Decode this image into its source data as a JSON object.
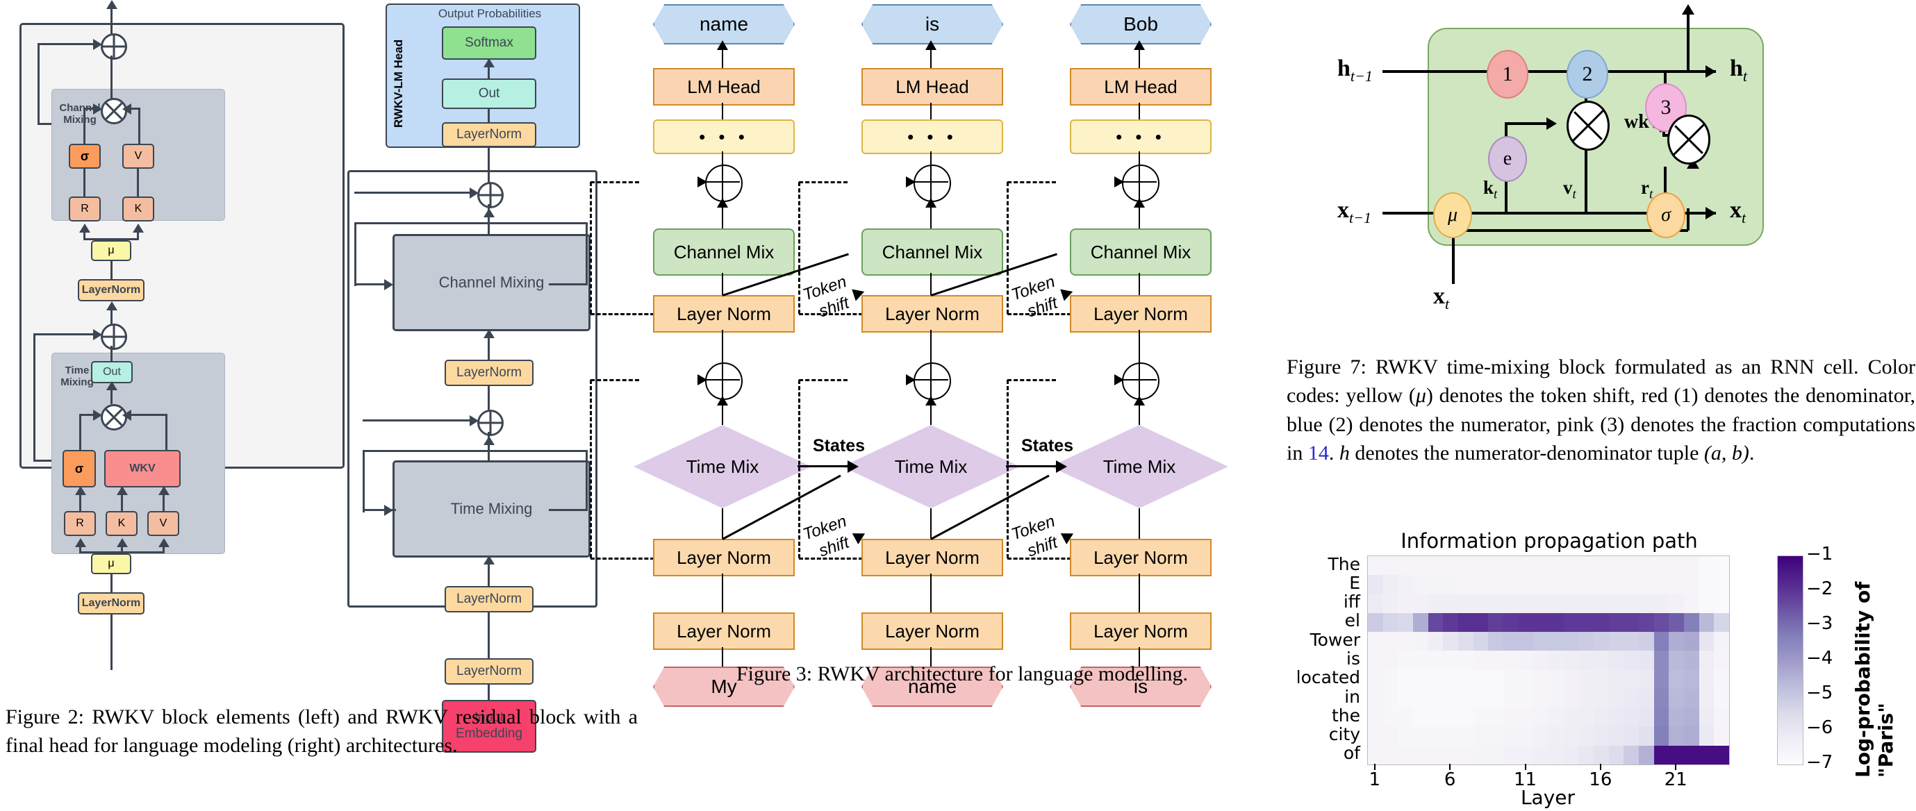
{
  "figure2": {
    "caption": "Figure 2:  RWKV block elements (left) and RWKV residual block with a final head for language modeling (right) architectures.",
    "left_panel": {
      "channel_mixing": {
        "label": "Channel\nMixing",
        "label_line1": "Channel",
        "label_line2": "Mixing",
        "nodes": [
          "σ",
          "V",
          "R",
          "K",
          "μ"
        ],
        "sigma": "σ",
        "v": "V",
        "r": "R",
        "k": "K",
        "mu": "μ"
      },
      "channel_layernorm": "LayerNorm",
      "time_mixing": {
        "label_line1": "Time",
        "label_line2": "Mixing",
        "out": "Out",
        "sigma": "σ",
        "wkv": "WKV",
        "r": "R",
        "k": "K",
        "v": "V",
        "mu": "μ"
      },
      "time_layernorm": "LayerNorm",
      "ops": {
        "add": "⊕",
        "mul": "⊗"
      }
    },
    "right_panel": {
      "head": {
        "title": "Output Probabilities",
        "side_label": "RWKV-LM Head",
        "softmax": "Softmax",
        "out": "Out",
        "layernorm": "LayerNorm"
      },
      "channel_mixing": "Channel Mixing",
      "layernorm_cm": "LayerNorm",
      "time_mixing": "Time Mixing",
      "layernorm_tm": "LayerNorm",
      "layernorm_in": "LayerNorm",
      "input_embedding_line1": "Input",
      "input_embedding_line2": "Embedding"
    }
  },
  "figure3": {
    "caption": "Figure 3: RWKV architecture for language modelling.",
    "columns": [
      {
        "output": "name",
        "lm_head": "LM Head",
        "ellipsis": "• • •",
        "channel_mix": "Channel Mix",
        "layer_norm_cm": "Layer Norm",
        "time_mix": "Time Mix",
        "layer_norm_tm": "Layer Norm",
        "layer_norm_in": "Layer Norm",
        "input": "My"
      },
      {
        "output": "is",
        "lm_head": "LM Head",
        "ellipsis": "• • •",
        "channel_mix": "Channel Mix",
        "layer_norm_cm": "Layer Norm",
        "time_mix": "Time Mix",
        "layer_norm_tm": "Layer Norm",
        "layer_norm_in": "Layer Norm",
        "input": "name"
      },
      {
        "output": "Bob",
        "lm_head": "LM Head",
        "ellipsis": "• • •",
        "channel_mix": "Channel Mix",
        "layer_norm_cm": "Layer Norm",
        "time_mix": "Time Mix",
        "layer_norm_tm": "Layer Norm",
        "layer_norm_in": "Layer Norm",
        "input": "is"
      }
    ],
    "edge_labels": {
      "token_shift_line1": "Token",
      "token_shift_line2": "shift",
      "states": "States"
    }
  },
  "figure7": {
    "caption_plain": "Figure 7: RWKV time-mixing block formulated as an RNN cell.  Color codes: yellow (μ) denotes the token shift, red (1) denotes the denominator, blue (2) denotes the numerator, pink (3) denotes the fraction computations in 14. h denotes the numerator-denominator tuple (a, b).",
    "caption_parts": {
      "p1": "Figure 7: RWKV time-mixing block formulated as an RNN cell.  Color codes: yellow (",
      "mu": "μ",
      "p2": ") denotes the token shift, red (1) denotes the denominator, blue (2) denotes the numerator, pink (3) denotes the fraction computations in ",
      "ref": "14",
      "p3": ". ",
      "h": "h",
      "p4": " denotes the numerator-denominator tuple ",
      "tuple": "(a, b)",
      "p5": "."
    },
    "diagram": {
      "h_prev": "h",
      "h_prev_sub": "t−1",
      "h_out": "h",
      "h_out_sub": "t",
      "x_prev": "x",
      "x_prev_sub": "t−1",
      "x_out": "x",
      "x_out_sub": "t",
      "x_in": "x",
      "x_in_sub": "t",
      "node1": "1",
      "node2": "2",
      "node3": "3",
      "node_e": "e",
      "node_mu": "μ",
      "node_sigma": "σ",
      "k_t": "k",
      "k_t_sub": "t",
      "v_t": "v",
      "v_t_sub": "t",
      "r_t": "r",
      "r_t_sub": "t",
      "wkv": "wkv",
      "wkv_sub": "t"
    },
    "colors": {
      "cell_bg": "#cfe6c1",
      "cell_border": "#7aa85e",
      "node1_red": "#f3aaa8",
      "node2_blue": "#aecbe8",
      "node3_pink": "#f5b6e0",
      "node_e_purple": "#d5c3e0",
      "node_mu_yellow": "#fcdf9c",
      "node_sigma_orange": "#fbd9a0"
    }
  },
  "chart_data": {
    "type": "heatmap",
    "title": "Information propagation path",
    "xlabel": "Layer",
    "ylabel": "",
    "colorbar_label": "Log-probability of \"Paris\"",
    "colorbar_ticks": [
      "−1",
      "−2",
      "−3",
      "−4",
      "−5",
      "−6",
      "−7"
    ],
    "zlim": [
      -7.4,
      -0.7
    ],
    "colormap": "Purples",
    "x_tick_labels": [
      "1",
      "6",
      "11",
      "16",
      "21"
    ],
    "x_tick_positions": [
      1,
      6,
      11,
      16,
      21
    ],
    "x_range": [
      1,
      24
    ],
    "y_tick_labels": [
      "The",
      "E",
      "iff",
      "el",
      "Tower",
      "is",
      "located",
      "in",
      "the",
      "city",
      "of"
    ],
    "rows": [
      {
        "token": "The",
        "values": [
          -7.0,
          -7.0,
          -7.0,
          -7.0,
          -7.0,
          -7.0,
          -7.0,
          -7.0,
          -7.0,
          -7.0,
          -7.0,
          -7.0,
          -7.0,
          -7.0,
          -7.0,
          -7.0,
          -7.0,
          -7.0,
          -7.0,
          -7.0,
          -7.0,
          -7.0,
          -7.2,
          -7.3
        ]
      },
      {
        "token": "E",
        "values": [
          -6.3,
          -6.6,
          -6.8,
          -6.9,
          -6.9,
          -6.9,
          -7.0,
          -7.0,
          -7.0,
          -7.0,
          -7.0,
          -7.0,
          -7.0,
          -7.0,
          -7.0,
          -7.0,
          -7.0,
          -7.0,
          -7.0,
          -7.0,
          -7.0,
          -7.0,
          -7.2,
          -7.3
        ]
      },
      {
        "token": "iff",
        "values": [
          -6.5,
          -6.7,
          -6.8,
          -6.8,
          -6.7,
          -6.7,
          -6.6,
          -6.6,
          -6.6,
          -6.6,
          -6.6,
          -6.6,
          -6.6,
          -6.6,
          -6.6,
          -6.6,
          -6.6,
          -6.6,
          -6.6,
          -6.7,
          -6.8,
          -7.0,
          -7.2,
          -7.3
        ]
      },
      {
        "token": "el",
        "values": [
          -5.3,
          -5.6,
          -5.7,
          -4.5,
          -2.2,
          -1.9,
          -1.7,
          -1.7,
          -2.0,
          -1.9,
          -1.8,
          -1.8,
          -1.8,
          -1.9,
          -1.9,
          -1.9,
          -2.0,
          -2.0,
          -2.1,
          -2.3,
          -2.6,
          -3.3,
          -4.8,
          -5.6
        ]
      },
      {
        "token": "Tower",
        "values": [
          -7.0,
          -7.0,
          -7.0,
          -6.9,
          -6.6,
          -6.2,
          -5.9,
          -5.6,
          -5.2,
          -5.1,
          -5.1,
          -5.2,
          -5.2,
          -5.2,
          -5.3,
          -5.4,
          -5.5,
          -5.5,
          -5.4,
          -3.3,
          -4.5,
          -4.4,
          -6.2,
          -6.9
        ]
      },
      {
        "token": "is",
        "values": [
          -7.0,
          -7.0,
          -7.1,
          -7.1,
          -7.1,
          -7.1,
          -7.1,
          -7.0,
          -7.0,
          -7.0,
          -6.9,
          -6.8,
          -6.7,
          -6.6,
          -6.5,
          -6.5,
          -6.4,
          -6.3,
          -6.2,
          -3.6,
          -4.8,
          -4.7,
          -6.6,
          -7.0
        ]
      },
      {
        "token": "located",
        "values": [
          -7.0,
          -7.1,
          -7.2,
          -7.2,
          -7.2,
          -7.2,
          -7.2,
          -7.2,
          -7.2,
          -7.1,
          -7.1,
          -7.0,
          -6.9,
          -6.8,
          -6.7,
          -6.6,
          -6.5,
          -6.5,
          -6.4,
          -3.6,
          -4.9,
          -4.8,
          -6.7,
          -7.1
        ]
      },
      {
        "token": "in",
        "values": [
          -7.0,
          -7.1,
          -7.2,
          -7.2,
          -7.2,
          -7.2,
          -7.2,
          -7.2,
          -7.2,
          -7.1,
          -7.1,
          -7.0,
          -6.9,
          -6.8,
          -6.7,
          -6.6,
          -6.5,
          -6.4,
          -6.3,
          -3.5,
          -4.8,
          -4.7,
          -6.6,
          -7.1
        ]
      },
      {
        "token": "the",
        "values": [
          -7.0,
          -7.1,
          -7.1,
          -7.2,
          -7.2,
          -7.2,
          -7.2,
          -7.1,
          -7.1,
          -7.0,
          -7.0,
          -6.9,
          -6.8,
          -6.7,
          -6.6,
          -6.5,
          -6.4,
          -6.3,
          -6.2,
          -3.4,
          -4.7,
          -4.6,
          -6.5,
          -7.0
        ]
      },
      {
        "token": "city",
        "values": [
          -7.0,
          -7.0,
          -7.1,
          -7.1,
          -7.1,
          -7.1,
          -7.1,
          -7.0,
          -7.0,
          -6.9,
          -6.9,
          -6.8,
          -6.7,
          -6.6,
          -6.5,
          -6.4,
          -6.3,
          -6.2,
          -6.0,
          -3.3,
          -4.6,
          -4.5,
          -6.4,
          -7.0
        ]
      },
      {
        "token": "of",
        "values": [
          -7.0,
          -7.0,
          -7.0,
          -7.0,
          -7.0,
          -7.0,
          -7.0,
          -6.9,
          -6.9,
          -6.8,
          -6.8,
          -6.7,
          -6.6,
          -6.5,
          -6.3,
          -6.1,
          -5.8,
          -5.3,
          -4.6,
          -1.0,
          -1.0,
          -1.0,
          -1.0,
          -1.0
        ]
      }
    ]
  },
  "palette": {
    "stroke": "#3c4653",
    "panel_outer": "#f4f4f5",
    "panel_inner": "#c5ccd6",
    "orange_strong": "#fb9b5c",
    "orange_soft": "#f5bda0",
    "yellow": "#fbf7a8",
    "layernorm": "#fdd9a0",
    "teal": "#b6f0e2",
    "red": "#f88e8e",
    "head_blue": "#c2dbf7",
    "green": "#8fe08f",
    "f3_blue": "#c5dcf2",
    "f3_lmhead": "#fbd5b2",
    "f3_ellipsis": "#fdf2c8",
    "f3_green": "#cde5c3",
    "f3_layernorm": "#fcd9ac",
    "f3_purple": "#ddcbe8",
    "f3_red": "#f4c2c2"
  }
}
